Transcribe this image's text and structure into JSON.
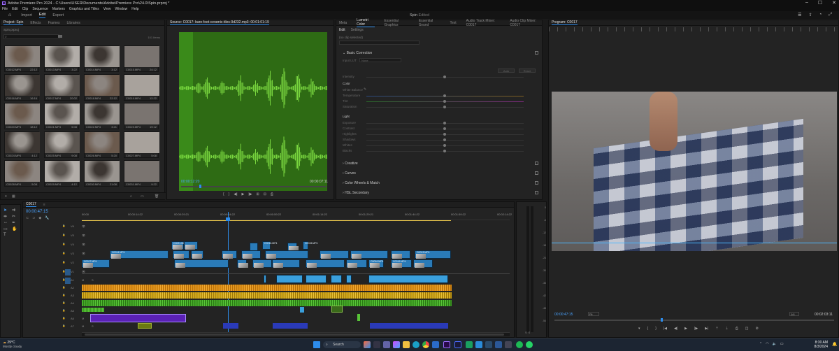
{
  "window": {
    "title": "Adobe Premiere Pro 2024 - C:\\Users\\USER\\Documents\\Adobe\\Premiere Pro\\24.0\\Spin.prproj *"
  },
  "menu": [
    "File",
    "Edit",
    "Clip",
    "Sequence",
    "Markers",
    "Graphics and Titles",
    "View",
    "Window",
    "Help"
  ],
  "workspace": {
    "tabs": [
      "Import",
      "Edit",
      "Export"
    ],
    "active": "Edit",
    "project_name": "Spin",
    "edited": "Edited"
  },
  "project_panel": {
    "tabs": [
      "Project: Spin",
      "Effects",
      "Frames",
      "Libraries"
    ],
    "bin": "Spin.prproj",
    "item_count": "101 Items",
    "clips": [
      {
        "name": "C0012.MP4",
        "dur": "22:12"
      },
      {
        "name": "C0013.MP4",
        "dur": "3:22"
      },
      {
        "name": "C0014.MP4",
        "dur": "3:12"
      },
      {
        "name": "C0015.MP4",
        "dur": "24:12"
      },
      {
        "name": "C0016.MP4",
        "dur": "16:16"
      },
      {
        "name": "C0017.MP4",
        "dur": "20:02"
      },
      {
        "name": "C0018.MP4",
        "dur": "22:12"
      },
      {
        "name": "C0019.MP4",
        "dur": "12:22"
      },
      {
        "name": "C0020.MP4",
        "dur": "18:12"
      },
      {
        "name": "C0021.MP4",
        "dur": "5:08"
      },
      {
        "name": "C0022.MP4",
        "dur": "3:21"
      },
      {
        "name": "C0023.MP4",
        "dur": "19:12"
      },
      {
        "name": "C0024.MP4",
        "dur": "4:12"
      },
      {
        "name": "C0025.MP4",
        "dur": "9:08"
      },
      {
        "name": "C0026.MP4",
        "dur": "5:20"
      },
      {
        "name": "C0027.MP4",
        "dur": "5:08"
      },
      {
        "name": "C0028.MP4",
        "dur": "5:08"
      },
      {
        "name": "C0029.MP4",
        "dur": "4:12"
      },
      {
        "name": "C0030.MP4",
        "dur": "21:08"
      },
      {
        "name": "C0031.MP4",
        "dur": "9:22"
      }
    ]
  },
  "source_monitor": {
    "title": "Source: C0017: bare-feet-ceramic-tiles-9d232.mp3: 00:01:01:19",
    "timecode": "00:00:12:20",
    "duration": "00:00:07:11"
  },
  "lumetri": {
    "tabs": [
      "Meta",
      "Lumetri Color",
      "Essential Graphics",
      "Essential Sound",
      "Text",
      "Audio Track Mixer: C0017",
      "Audio Clip Mixer: C0017"
    ],
    "subtabs": [
      "Edit",
      "Settings"
    ],
    "no_clip": "(no clip selected)",
    "sections": [
      "Basic Correction",
      "Creative",
      "Curves",
      "Color Wheels & Match",
      "HSL Secondary"
    ],
    "input_lut_label": "Input LUT",
    "input_lut_value": "None",
    "auto": "Auto",
    "reset": "Reset",
    "intensity": "Intensity",
    "color_h": "Color",
    "color_rows": [
      "White Balance",
      "Temperature",
      "Tint",
      "Saturation"
    ],
    "light_h": "Light",
    "light_rows": [
      "Exposure",
      "Contrast",
      "Highlights",
      "Shadows",
      "Whites",
      "Blacks"
    ]
  },
  "program_monitor": {
    "title": "Program: C0017",
    "timecode": "00:00:47:15",
    "fit": "Fit",
    "quality": "1/4",
    "duration": "00:02:03:11"
  },
  "timeline": {
    "sequence": "C0017",
    "timecode": "00:00:47:15",
    "ruler": [
      "00:00",
      "00:00:14:22",
      "00:00:29:21",
      "00:00:44:22",
      "00:00:59:22",
      "00:01:14:22",
      "00:01:29:21",
      "00:01:44:22",
      "00:01:59:22",
      "00:02:14:22"
    ],
    "tracks": [
      "V6",
      "V5",
      "V4",
      "V3",
      "V2",
      "V1",
      "A1",
      "A2",
      "A3",
      "A4",
      "A5",
      "A6",
      "A7"
    ],
    "clip_names": [
      "C0021.MP4",
      "C0018.MP4",
      "C0015.MP4",
      "C0014.MP4",
      "C0013.MP4",
      "C0017.MP4",
      "C0016.MP4",
      "C0019.MP4",
      "C0022.MP4"
    ]
  },
  "meter_labels": [
    "0",
    "-6",
    "-12",
    "-18",
    "-24",
    "-30",
    "-36",
    "-42",
    "-48",
    "-54"
  ],
  "taskbar": {
    "weather_temp": "29°C",
    "weather_desc": "Mostly cloudy",
    "search": "Search",
    "time": "8:30 AM",
    "date": "8/3/2024"
  },
  "colors": {
    "accent": "#2d8ceb",
    "waveform_bg": "#2e6b14",
    "video_clip": "#2a7bb8",
    "audio_clip": "#3a9fdc",
    "purple_clip": "#5b21b6"
  }
}
